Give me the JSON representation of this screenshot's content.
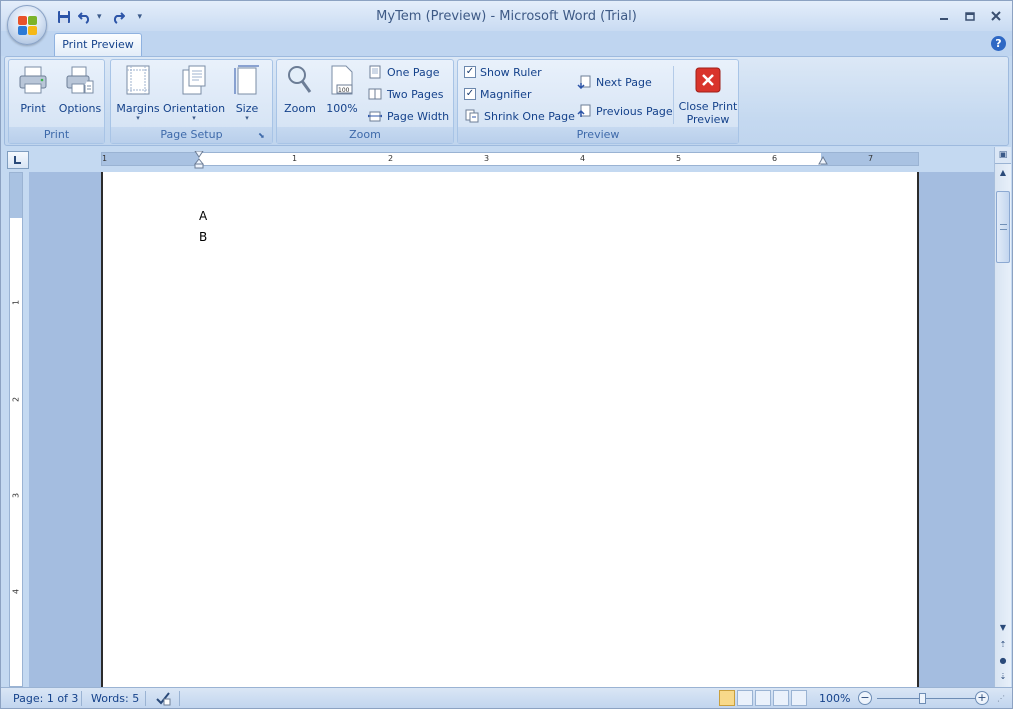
{
  "title": "MyTem (Preview) - Microsoft Word (Trial)",
  "tab": "Print Preview",
  "help": "?",
  "ribbon": {
    "print_group": {
      "label": "Print",
      "print": "Print",
      "options": "Options"
    },
    "page_setup_group": {
      "label": "Page Setup",
      "margins": "Margins",
      "orientation": "Orientation",
      "size": "Size"
    },
    "zoom_group": {
      "label": "Zoom",
      "zoom": "Zoom",
      "hundred": "100%",
      "one_page": "One Page",
      "two_pages": "Two Pages",
      "page_width": "Page Width"
    },
    "preview_group": {
      "label": "Preview",
      "show_ruler": "Show Ruler",
      "show_ruler_checked": true,
      "magnifier": "Magnifier",
      "magnifier_checked": true,
      "shrink_one_page": "Shrink One Page",
      "next_page": "Next Page",
      "previous_page": "Previous Page",
      "close_preview": "Close Print Preview",
      "close_line1": "Close Print",
      "close_line2": "Preview"
    }
  },
  "ruler": {
    "h_ticks": [
      "1",
      "1",
      "2",
      "3",
      "4",
      "5",
      "6",
      "7"
    ],
    "v_ticks": [
      "1",
      "2",
      "3",
      "4"
    ]
  },
  "document": {
    "lines": [
      "A",
      "B"
    ]
  },
  "status": {
    "page": "Page: 1 of 3",
    "words": "Words: 5",
    "zoom": "100%"
  },
  "colors": {
    "accent": "#15428b",
    "ribbon": "#d2e1f3",
    "workspace": "#a4bde0",
    "close_red": "#d9342b"
  }
}
